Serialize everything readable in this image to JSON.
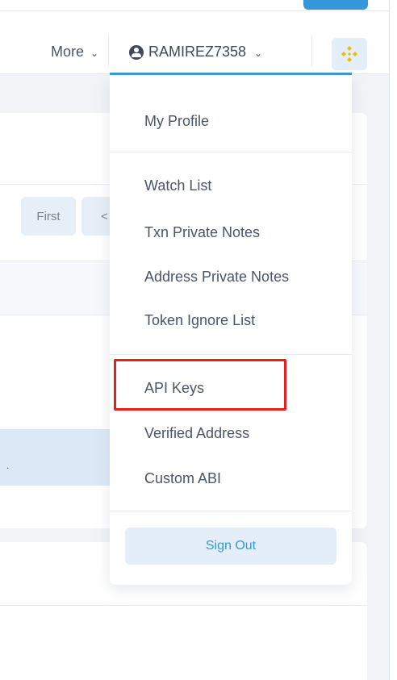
{
  "header": {
    "more_label": "More",
    "username": "RAMIREZ7358",
    "brand_color": "#3498db",
    "bnb_color": "#f0b90b"
  },
  "pagination": {
    "first_label": "First",
    "prev_label": "<"
  },
  "background": {
    "row_mark": "."
  },
  "dropdown": {
    "my_profile": "My Profile",
    "watch_list": "Watch List",
    "txn_private_notes": "Txn Private Notes",
    "address_private_notes": "Address Private Notes",
    "token_ignore_list": "Token Ignore List",
    "api_keys": "API Keys",
    "verified_address": "Verified Address",
    "custom_abi": "Custom ABI",
    "sign_out": "Sign Out",
    "highlight_color": "#e6201f"
  }
}
